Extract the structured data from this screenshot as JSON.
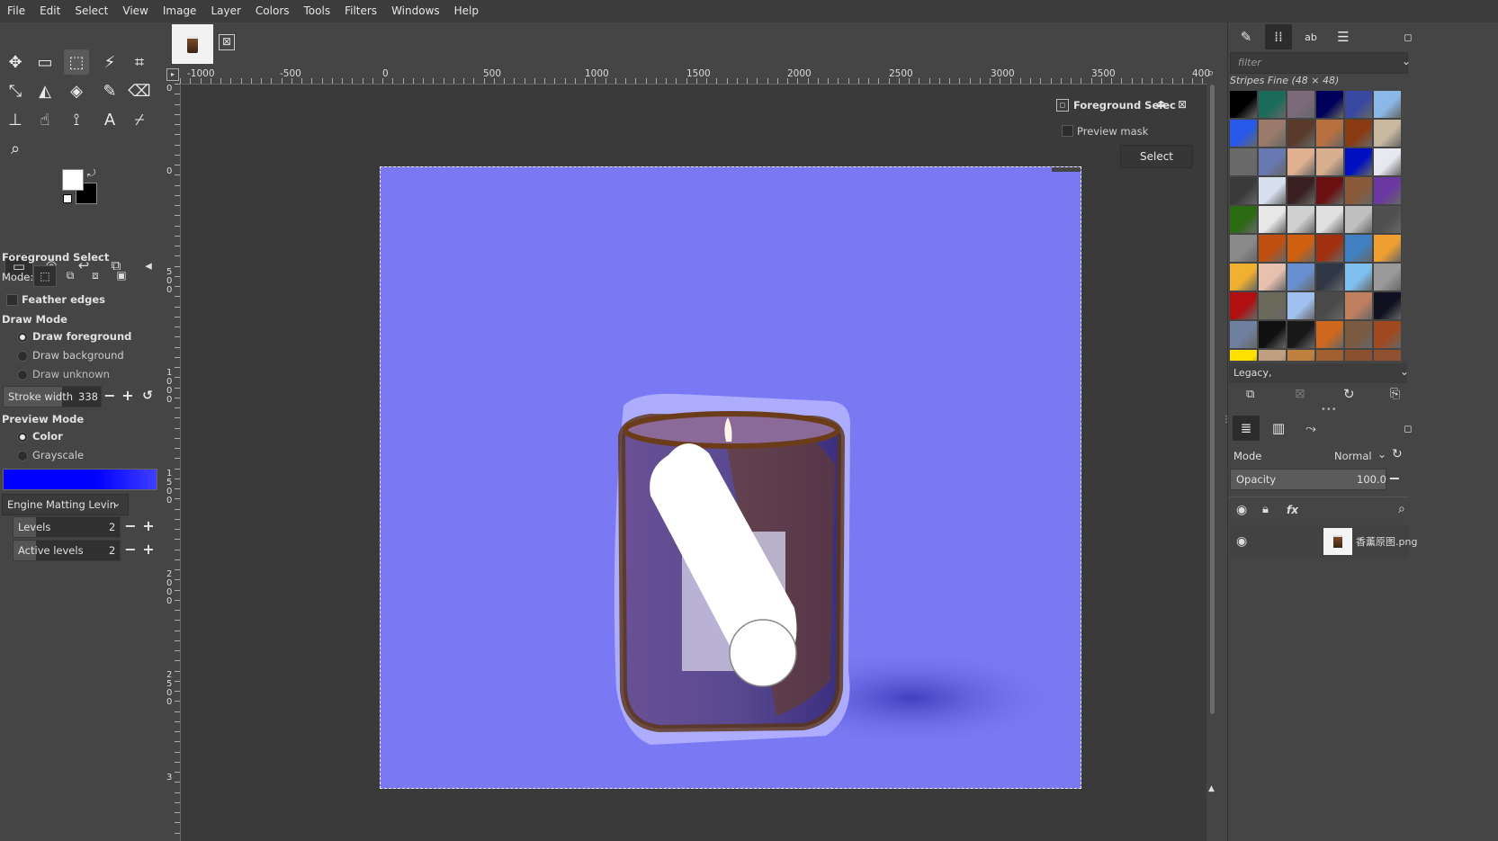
{
  "menubar": {
    "items": [
      "File",
      "Edit",
      "Select",
      "View",
      "Image",
      "Layer",
      "Colors",
      "Tools",
      "Filters",
      "Windows",
      "Help"
    ]
  },
  "toolbox": {
    "tools": [
      {
        "icon": "move-icon",
        "glyph": "✥"
      },
      {
        "icon": "rect-select-icon",
        "glyph": "▭"
      },
      {
        "icon": "foreground-select-icon",
        "glyph": "⬚"
      },
      {
        "icon": "fuzzy-select-icon",
        "glyph": "⚡"
      },
      {
        "icon": "crop-icon",
        "glyph": "⌗"
      },
      {
        "icon": "unified-transform-icon",
        "glyph": "⤡"
      },
      {
        "icon": "warp-transform-icon",
        "glyph": "◭"
      },
      {
        "icon": "bucket-fill-icon",
        "glyph": "◈"
      },
      {
        "icon": "paintbrush-icon",
        "glyph": "✎"
      },
      {
        "icon": "eraser-icon",
        "glyph": "⌫"
      },
      {
        "icon": "clone-icon",
        "glyph": "⊥"
      },
      {
        "icon": "smudge-icon",
        "glyph": "☝"
      },
      {
        "icon": "paths-icon",
        "glyph": "⟟"
      },
      {
        "icon": "text-icon",
        "glyph": "A"
      },
      {
        "icon": "color-picker-icon",
        "glyph": "⌿"
      },
      {
        "icon": "zoom-icon",
        "glyph": "⌕"
      }
    ]
  },
  "tool_options": {
    "title": "Foreground Select",
    "mode_label": "Mode:",
    "feather_edges": "Feather edges",
    "draw_mode_title": "Draw Mode",
    "draw_foreground": "Draw foreground",
    "draw_background": "Draw background",
    "draw_unknown": "Draw unknown",
    "stroke_width_label": "Stroke width",
    "stroke_width_value": "338",
    "preview_mode_title": "Preview Mode",
    "preview_color": "Color",
    "preview_grayscale": "Grayscale",
    "engine_label": "Engine",
    "engine_value": "Matting Levin",
    "levels_label": "Levels",
    "levels_value": "2",
    "active_levels_label": "Active levels",
    "active_levels_value": "2",
    "preview_color_swatch": "#0000ff"
  },
  "canvas": {
    "hruler_labels": [
      "-1000",
      "-500",
      "0",
      "500",
      "1000",
      "1500",
      "2000",
      "2500",
      "3000",
      "3500",
      "400"
    ],
    "vruler_labels": [
      "0",
      "0",
      "500",
      "1000",
      "1500",
      "2000",
      "2500",
      "3"
    ],
    "image_bg_color": "#7a78f3",
    "tab_close_glyph": "⊠"
  },
  "fg_dialog": {
    "title": "Foreground Selec",
    "preview_mask": "Preview mask",
    "select_button": "Select"
  },
  "patterns": {
    "filter_placeholder": "filter",
    "current": "Stripes Fine (48 × 48)",
    "tag_value": "Legacy,"
  },
  "layers": {
    "mode_label": "Mode",
    "mode_value": "Normal",
    "opacity_label": "Opacity",
    "opacity_value": "100.0",
    "layer_name": "香薰原图.png"
  }
}
